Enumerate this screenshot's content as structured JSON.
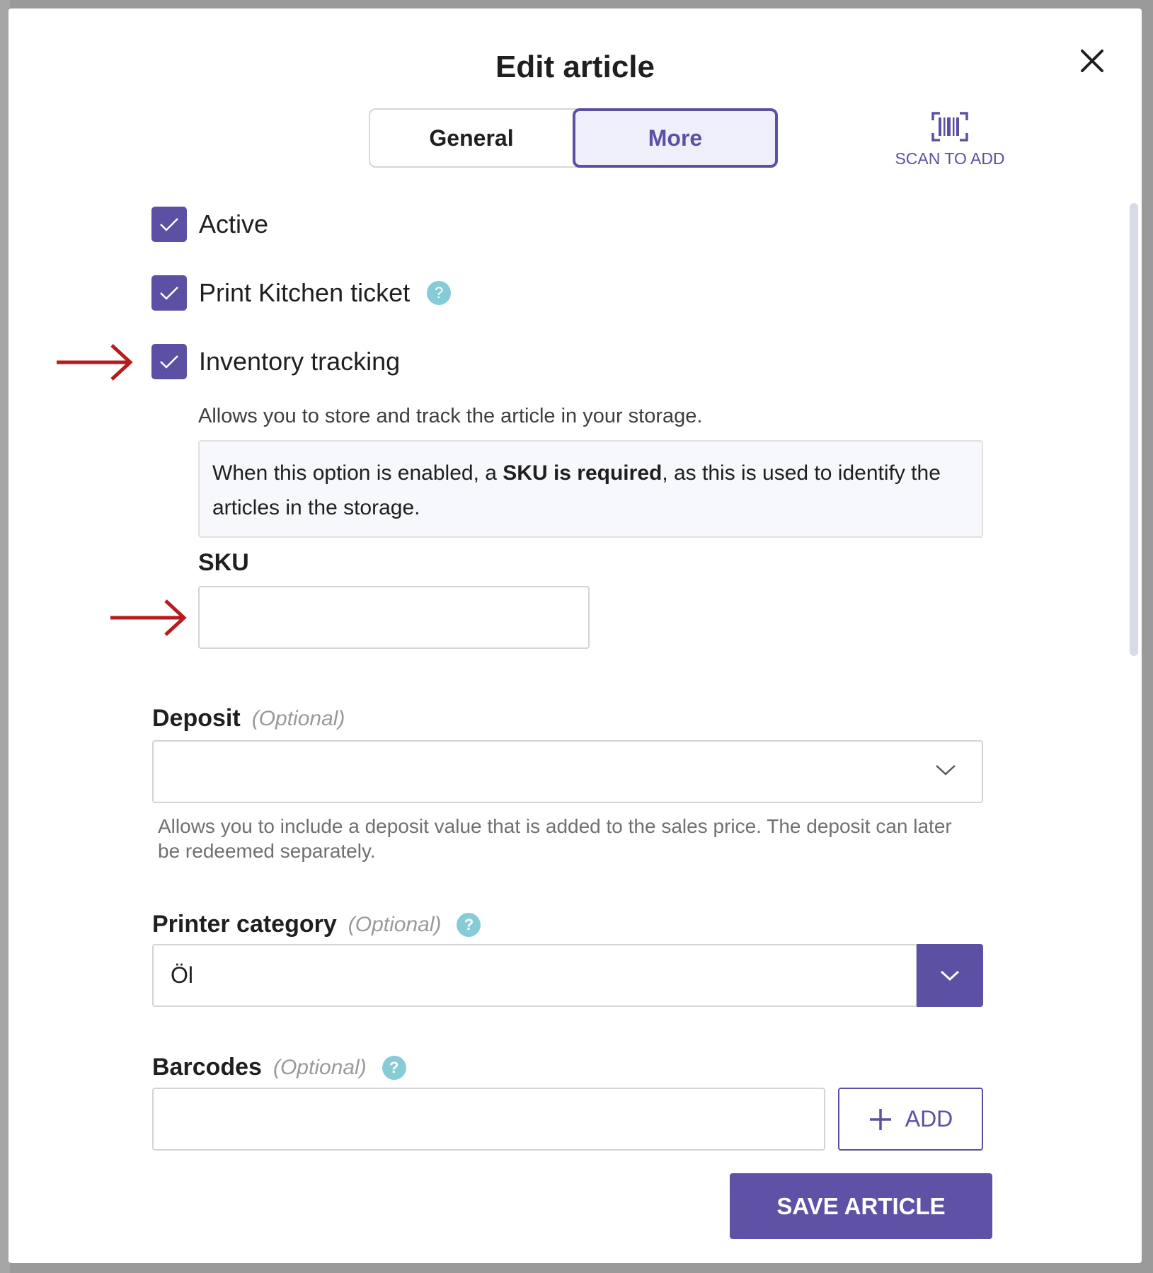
{
  "modal": {
    "title": "Edit article",
    "close_icon": "close-icon"
  },
  "tabs": [
    {
      "label": "General",
      "active": false
    },
    {
      "label": "More",
      "active": true
    }
  ],
  "scan": {
    "label": "SCAN TO ADD",
    "icon": "barcode-scan-icon"
  },
  "checkboxes": {
    "active": {
      "label": "Active",
      "checked": true
    },
    "print_kitchen": {
      "label": "Print Kitchen ticket",
      "checked": true
    },
    "inventory": {
      "label": "Inventory tracking",
      "checked": true
    }
  },
  "inventory": {
    "hint": "Allows you to store and track the article in your storage.",
    "info_prefix": "When this option is enabled, a ",
    "info_bold": "SKU is required",
    "info_suffix": ", as this is used to identify the articles in the storage."
  },
  "sku": {
    "label": "SKU",
    "value": ""
  },
  "deposit": {
    "label": "Deposit",
    "optional": "(Optional)",
    "value": "",
    "hint": "Allows you to include a deposit value that is added to the sales price. The deposit can later be redeemed separately."
  },
  "printer_category": {
    "label": "Printer category",
    "optional": "(Optional)",
    "value": "Öl"
  },
  "barcodes": {
    "label": "Barcodes",
    "optional": "(Optional)",
    "value": "",
    "add_label": "ADD"
  },
  "footer": {
    "save_label": "SAVE ARTICLE"
  },
  "colors": {
    "accent": "#5b50a3",
    "help": "#86ccd6",
    "annotation_arrow": "#b71c1c"
  }
}
